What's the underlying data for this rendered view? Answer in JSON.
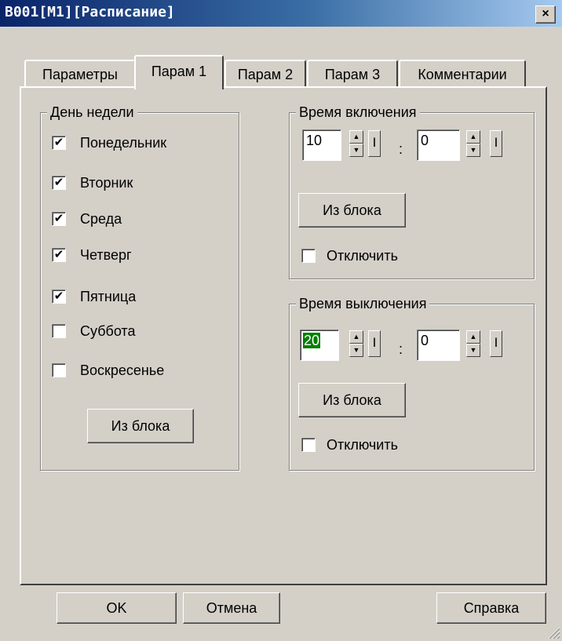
{
  "window": {
    "title": "B001[M1][Расписание]",
    "close_symbol": "×"
  },
  "tabs": [
    {
      "label": "Параметры",
      "active": false
    },
    {
      "label": "Парам 1",
      "active": true
    },
    {
      "label": "Парам 2",
      "active": false
    },
    {
      "label": "Парам 3",
      "active": false
    },
    {
      "label": "Комментарии",
      "active": false
    }
  ],
  "weekday_group": {
    "legend": "День недели",
    "days": [
      {
        "label": "Понедельник",
        "checked": true
      },
      {
        "label": "Вторник",
        "checked": true
      },
      {
        "label": "Среда",
        "checked": true
      },
      {
        "label": "Четверг",
        "checked": true
      },
      {
        "label": "Пятница",
        "checked": true
      },
      {
        "label": "Суббота",
        "checked": false
      },
      {
        "label": "Воскресенье",
        "checked": false
      }
    ],
    "from_block_label": "Из блока"
  },
  "on_time": {
    "legend": "Время включения",
    "hours": "10",
    "minutes": "0",
    "separator": ":",
    "i_button": "I",
    "from_block_label": "Из блока",
    "disable_label": "Отключить",
    "disable_checked": false
  },
  "off_time": {
    "legend": "Время выключения",
    "hours": "20",
    "minutes": "0",
    "separator": ":",
    "i_button": "I",
    "from_block_label": "Из блока",
    "disable_label": "Отключить",
    "disable_checked": false
  },
  "footer": {
    "ok_label": "OK",
    "cancel_label": "Отмена",
    "help_label": "Справка"
  },
  "check_mark": "✔",
  "spin_up": "▲",
  "spin_down": "▼"
}
